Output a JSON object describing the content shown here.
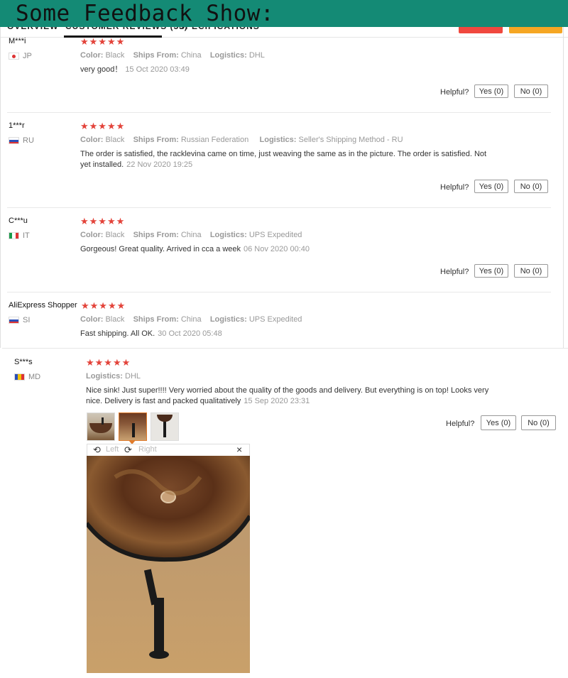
{
  "banner": {
    "text": "Some Feedback Show:"
  },
  "tabs": [
    {
      "label": "OVERVIEW"
    },
    {
      "label": "CUSTOMER REVIEWS (33)"
    },
    {
      "label": "SPECIFICATIONS"
    }
  ],
  "buttons": {
    "buy": "",
    "cart": ""
  },
  "labels": {
    "color": "Color:",
    "ships_from": "Ships From:",
    "logistics": "Logistics:",
    "helpful": "Helpful?"
  },
  "reviews": [
    {
      "user": "M***i",
      "country": "JP",
      "stars": "★★★★★",
      "color": "Black",
      "ships_from": "China",
      "logistics": "DHL",
      "text": "very good！",
      "date": "15 Oct 2020 03:49",
      "yes": "Yes (0)",
      "no": "No (0)"
    },
    {
      "user": "1***r",
      "country": "RU",
      "stars": "★★★★★",
      "color": "Black",
      "ships_from": "Russian Federation",
      "logistics": "Seller's Shipping Method - RU",
      "text": "The order is satisfied, the racklevina came on time, just weaving the same as in the picture. The order is satisfied. Not yet installed.",
      "date": "22 Nov 2020 19:25",
      "yes": "Yes (0)",
      "no": "No (0)"
    },
    {
      "user": "C***u",
      "country": "IT",
      "stars": "★★★★★",
      "color": "Black",
      "ships_from": "China",
      "logistics": "UPS Expedited",
      "text": "Gorgeous! Great quality. Arrived in cca a week",
      "date": "06 Nov 2020 00:40",
      "yes": "Yes (0)",
      "no": "No (0)"
    },
    {
      "user": "AliExpress Shopper",
      "country": "SI",
      "stars": "★★★★★",
      "color": "Black",
      "ships_from": "China",
      "logistics": "UPS Expedited",
      "text": "Fast shipping. All OK.",
      "date": "30 Oct 2020 05:48"
    },
    {
      "user": "S***s",
      "country": "MD",
      "stars": "★★★★★",
      "logistics": "DHL",
      "text": "Nice sink! Just super!!!! Very worried about the quality of the goods and delivery. But everything is on top! Looks very nice. Delivery is fast and packed qualitatively",
      "date": "15 Sep 2020 23:31",
      "yes": "Yes (0)",
      "no": "No (0)"
    }
  ],
  "viewer": {
    "left": "Left",
    "right": "Right",
    "close": "×"
  },
  "watermark": "",
  "icons": {
    "rotate_left": "rotate-left-icon",
    "rotate_right": "rotate-right-icon",
    "close": "close-icon"
  },
  "colors": {
    "banner": "#148a75",
    "stars": "#e3433a",
    "buy_button": "#f0483e",
    "cart_button": "#f5a623",
    "selected_thumb": "#e07b2a"
  }
}
